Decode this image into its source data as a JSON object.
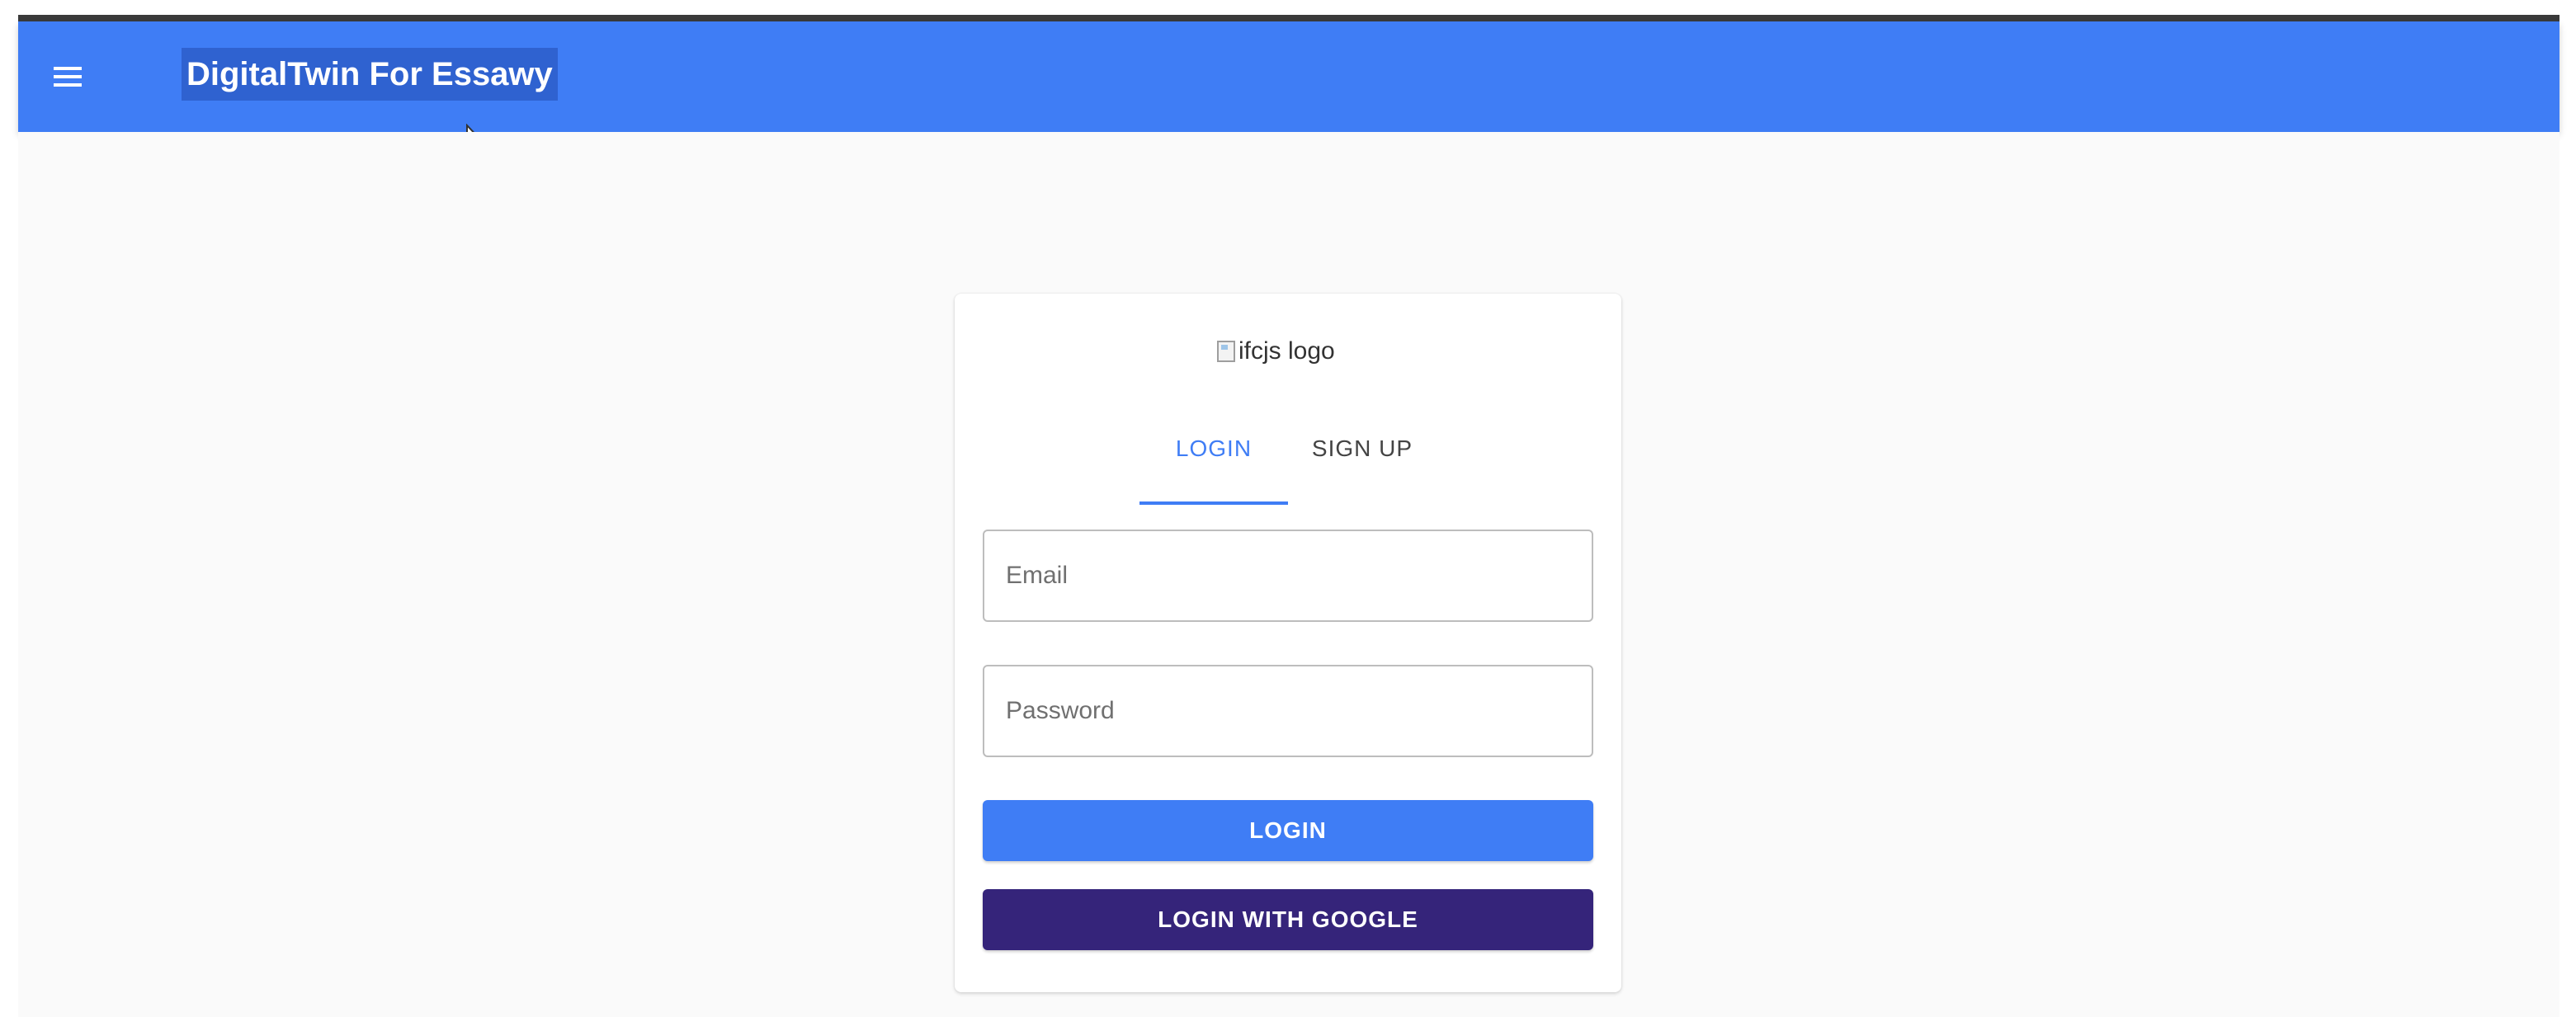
{
  "app_bar": {
    "title": "DigitalTwin For Essawy",
    "menu_icon": "menu-icon",
    "color": "#3f7df5"
  },
  "card": {
    "logo_alt": "ifcjs logo",
    "tabs": [
      {
        "label": "LOGIN",
        "active": true
      },
      {
        "label": "SIGN UP",
        "active": false
      }
    ],
    "email": {
      "placeholder": "Email",
      "value": ""
    },
    "password": {
      "placeholder": "Password",
      "value": ""
    },
    "login_button": "LOGIN",
    "google_button": "LOGIN WITH GOOGLE",
    "colors": {
      "primary": "#3f7df5",
      "google_button": "#35247a"
    }
  }
}
